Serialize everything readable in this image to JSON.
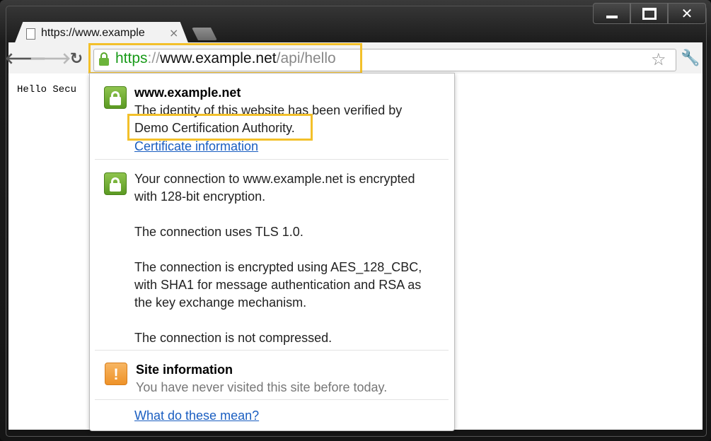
{
  "tab": {
    "title": "https://www.example",
    "close_glyph": "×"
  },
  "toolbar": {
    "back_glyph": "🡐",
    "forward_glyph": "🡒",
    "reload_glyph": "↻",
    "star_glyph": "☆",
    "wrench_glyph": "🔧"
  },
  "window": {
    "close_glyph": "✕"
  },
  "url": {
    "scheme": "https",
    "separator": "://",
    "host": "www.example.net",
    "path": "/api/hello"
  },
  "page": {
    "visible_text": "Hello Secu"
  },
  "popup": {
    "identity": {
      "host": "www.example.net",
      "line1": "The identity of this website has been verified by",
      "authority": "Demo Certification Authority.",
      "cert_link": "Certificate information"
    },
    "connection": {
      "line1": "Your connection to www.example.net is encrypted",
      "line2": "with 128-bit encryption.",
      "tls": "The connection uses TLS 1.0.",
      "cipher1": "The connection is encrypted using AES_128_CBC,",
      "cipher2": "with SHA1 for message authentication and RSA as",
      "cipher3": "the key exchange mechanism.",
      "compression": "The connection is not compressed."
    },
    "site_info": {
      "title": "Site information",
      "text": "You have never visited this site before today.",
      "icon_glyph": "!"
    },
    "help_link": "What do these mean?"
  },
  "colors": {
    "secure_green": "#189a18",
    "highlight": "#f3c02a",
    "link": "#1a5ec1",
    "warning_orange": "#ee9228"
  }
}
